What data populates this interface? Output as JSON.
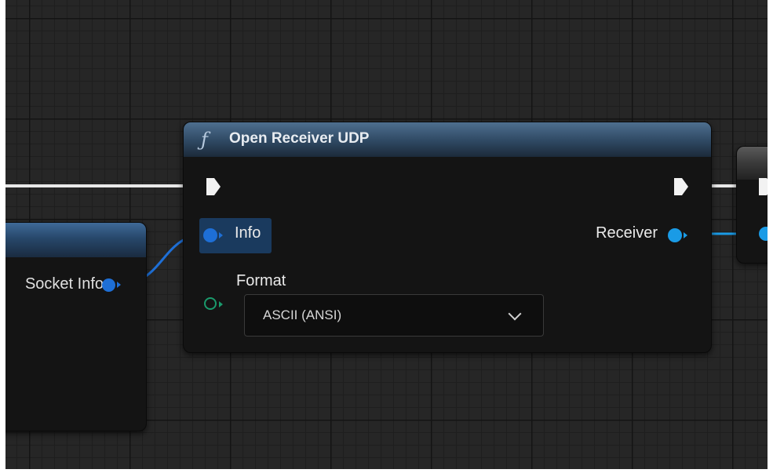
{
  "graph": {
    "wires": {
      "exec_color": "#e8e8e8",
      "data_color": "#1e6fd6",
      "receiver_color": "#1a9be6"
    }
  },
  "left_node": {
    "output_pin_label": "Socket Info",
    "pin_color": "#1e6fd6"
  },
  "main_node": {
    "icon": "function-icon",
    "icon_glyph": "ƒ",
    "title": "Open Receiver UDP",
    "header_color": "#2e4862",
    "inputs": {
      "exec": {
        "icon": "exec-in-icon"
      },
      "info": {
        "label": "Info",
        "pin_color": "#1e6fd6"
      },
      "format": {
        "label": "Format",
        "pin_color": "#1a9a6c",
        "selected_value": "ASCII (ANSI)"
      }
    },
    "outputs": {
      "exec": {
        "icon": "exec-out-icon"
      },
      "receiver": {
        "label": "Receiver",
        "pin_color": "#1a9be6"
      }
    }
  },
  "right_node": {
    "input_exec_icon": "exec-in-icon",
    "input_pin_color": "#1a9be6"
  }
}
